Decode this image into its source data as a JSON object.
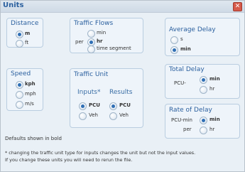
{
  "window": {
    "title": "Units"
  },
  "distance": {
    "label": "Distance",
    "opt_m": "m",
    "opt_ft": "ft"
  },
  "speed": {
    "label": "Speed",
    "opt_kph": "kph",
    "opt_mph": "mph",
    "opt_ms": "m/s"
  },
  "traffic_flows": {
    "label": "Traffic Flows",
    "per": "per",
    "opt_min": "min",
    "opt_hr": "hr",
    "opt_seg": "time segment"
  },
  "traffic_unit": {
    "label": "Traffic Unit",
    "inputs": "Inputs*",
    "results": "Results",
    "in_pcu": "PCU",
    "in_veh": "Veh",
    "res_pcu": "PCU",
    "res_veh": "Veh"
  },
  "average_delay": {
    "label": "Average Delay",
    "opt_s": "s",
    "opt_min": "min"
  },
  "total_delay": {
    "label": "Total Delay",
    "prefix": "PCU-",
    "opt_min": "min",
    "opt_hr": "hr"
  },
  "rate_of_delay": {
    "label": "Rate of Delay",
    "prefix": "PCU-min",
    "per": "per",
    "opt_min": "min",
    "opt_hr": "hr"
  },
  "footer": {
    "defaults": "Defaults shown in bold",
    "note1": "* changing the traffic unit type for inputs changes the unit but not the input values.",
    "note2": "If you change these units you will need to rerun the file."
  }
}
